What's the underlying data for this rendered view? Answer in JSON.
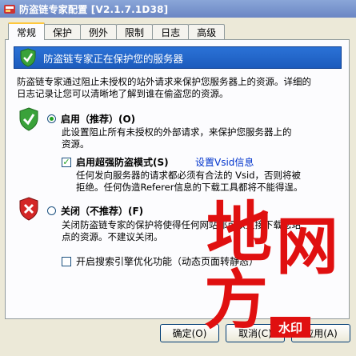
{
  "window": {
    "title": "防盗链专家配置 [V2.1.7.1D38]"
  },
  "tabs": [
    "常规",
    "保护",
    "例外",
    "限制",
    "日志",
    "高级"
  ],
  "active_tab": 0,
  "banner": {
    "text": "防盗链专家正在保护您的服务器"
  },
  "intro": {
    "line1": "防盗链专家通过阻止未授权的站外请求来保护您服务器上的资源。详细的",
    "line2": "日志记录让您可以清晰地了解到谁在偷盗您的资源。"
  },
  "enable_option": {
    "label": "启用（推荐）(O)",
    "checked": true,
    "desc_line1": "此设置阻止所有未授权的外部请求，来保护您服务器上的",
    "desc_line2": "资源。"
  },
  "super_mode": {
    "label": "启用超强防盗模式(S)",
    "checked": true,
    "vsid_link": "设置Vsid信息",
    "desc_line1": "任何发向服务器的请求都必须有合法的 Vsid，否则将被",
    "desc_line2": "拒绝。任何伪造Referer信息的下载工具都将不能得逞。"
  },
  "disable_option": {
    "label": "关闭（不推荐）(F)",
    "checked": false,
    "desc_line1": "关闭防盗链专家的保护将使得任何网站都可以直接下载您站",
    "desc_line2": "点的资源。不建议关闭。"
  },
  "seo_option": {
    "label": "开启搜索引擎优化功能（动态页面转静态）",
    "checked": false
  },
  "buttons": {
    "ok": "确定(O)",
    "cancel": "取消(C)",
    "apply": "应用(A)"
  },
  "watermark": {
    "chars": [
      "地",
      "网",
      "方"
    ],
    "badge": "水印"
  },
  "colors": {
    "title_bar": "#7b96cc",
    "banner": "#1f62c8",
    "shield_green": "#3aa23a",
    "shield_red": "#d42626",
    "watermark_red": "#e01010",
    "tab_highlight": "#ffc83c"
  }
}
